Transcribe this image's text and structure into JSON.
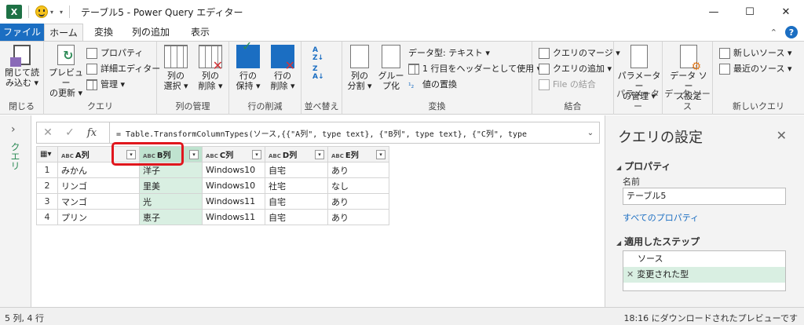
{
  "window": {
    "title": "テーブル5 - Power Query エディター",
    "app_icon": "excel-icon",
    "minimize": "—",
    "maximize": "☐",
    "close": "✕"
  },
  "tabs": [
    {
      "label": "ファイル"
    },
    {
      "label": "ホーム"
    },
    {
      "label": "変換"
    },
    {
      "label": "列の追加"
    },
    {
      "label": "表示"
    }
  ],
  "ribbon": {
    "groups": {
      "close": {
        "label": "閉じる",
        "btn": "閉じて読\nみ込む ▾"
      },
      "query": {
        "label": "クエリ",
        "preview": "プレビュー\nの更新 ▾",
        "properties": "プロパティ",
        "adv_editor": "詳細エディター",
        "manage": "管理 ▾"
      },
      "manage_cols": {
        "label": "列の管理",
        "choose": "列の\n選択 ▾",
        "remove": "列の\n削除 ▾"
      },
      "reduce_rows": {
        "label": "行の削減",
        "keep": "行の\n保持 ▾",
        "remove": "行の\n削除 ▾"
      },
      "sort": {
        "label": "並べ替え"
      },
      "transform": {
        "label": "変換",
        "split": "列の\n分割 ▾",
        "group": "グルー\nプ化",
        "datatype": "データ型: テキスト ▾",
        "first_row": "1 行目をヘッダーとして使用 ▾",
        "replace": "値の置換"
      },
      "combine": {
        "label": "結合",
        "merge": "クエリのマージ ▾",
        "append": "クエリの追加 ▾",
        "file_combine": "File の結合"
      },
      "params": {
        "label": "パラメーター",
        "manage": "パラメーター\nの管理 ▾"
      },
      "datasource": {
        "label": "データ ソース",
        "settings": "データ ソー\nス設定"
      },
      "newquery": {
        "label": "新しいクエリ",
        "new_source": "新しいソース ▾",
        "recent": "最近のソース ▾"
      }
    }
  },
  "query_pane": {
    "label": "クエリ"
  },
  "formula_bar": {
    "fx": "fx",
    "formula": "= Table.TransformColumnTypes(ソース,{{\"A列\", type text}, {\"B列\", type text}, {\"C列\", type"
  },
  "table": {
    "type_badge": "A B C",
    "columns": [
      "A列",
      "B列",
      "C列",
      "D列",
      "E列"
    ],
    "rows": [
      {
        "n": "1",
        "cells": [
          "みかん",
          "洋子",
          "Windows10",
          "自宅",
          "あり"
        ]
      },
      {
        "n": "2",
        "cells": [
          "リンゴ",
          "里美",
          "Windows10",
          "社宅",
          "なし"
        ]
      },
      {
        "n": "3",
        "cells": [
          "マンゴ",
          "光",
          "Windows11",
          "自宅",
          "あり"
        ]
      },
      {
        "n": "4",
        "cells": [
          "プリン",
          "恵子",
          "Windows11",
          "自宅",
          "あり"
        ]
      }
    ],
    "selected_column": "B列"
  },
  "settings": {
    "title": "クエリの設定",
    "properties_header": "プロパティ",
    "name_label": "名前",
    "name_value": "テーブル5",
    "all_props_link": "すべてのプロパティ",
    "steps_header": "適用したステップ",
    "steps": [
      "ソース",
      "変更された型"
    ]
  },
  "status": {
    "left": "5 列, 4 行",
    "right": "18:16 にダウンロードされたプレビューです"
  },
  "colors": {
    "excel_green": "#1e7145",
    "file_tab": "#1b6ec2",
    "selection": "#d9efe2",
    "highlight_box": "#e0161d"
  }
}
